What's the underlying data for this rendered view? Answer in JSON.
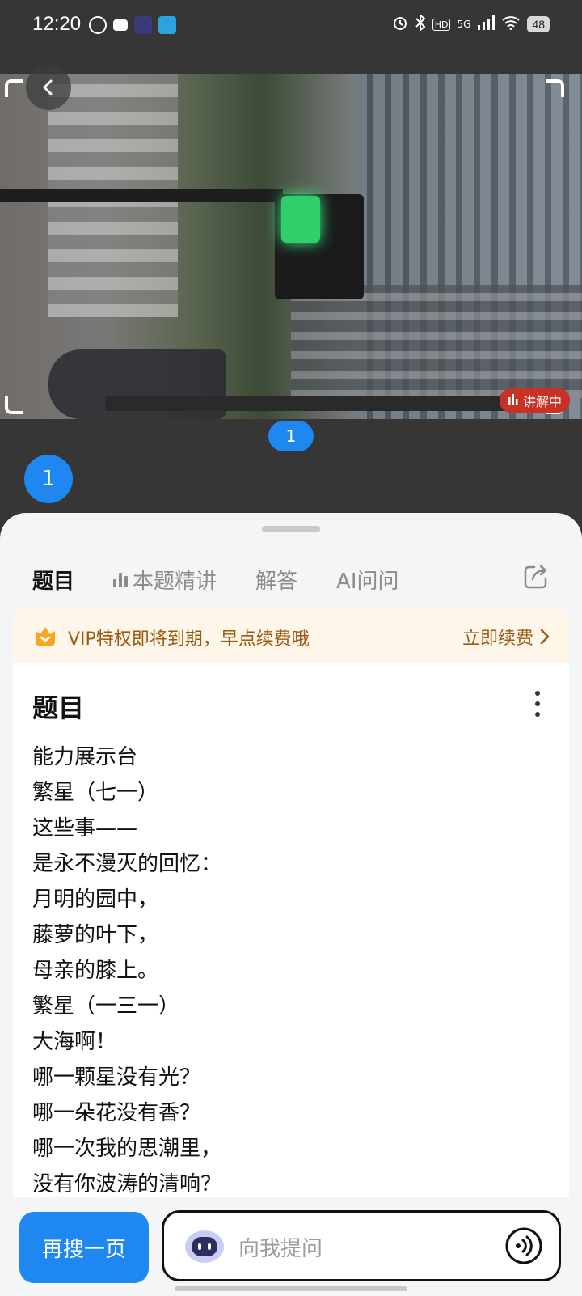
{
  "status_bar": {
    "time": "12:20",
    "signal": "5G",
    "hd": "HD",
    "battery": "48"
  },
  "photo": {
    "live_badge": "讲解中",
    "marker_number": "1"
  },
  "question_number": "1",
  "tabs": [
    {
      "label": "题目",
      "active": true
    },
    {
      "label": "本题精讲",
      "active": false
    },
    {
      "label": "解答",
      "active": false
    },
    {
      "label": "AI问问",
      "active": false
    }
  ],
  "vip": {
    "text": "VIP特权即将到期，早点续费哦",
    "renew": "立即续费"
  },
  "card": {
    "title": "题目",
    "lines": [
      "能力展示台",
      "繁星（七一）",
      "这些事——",
      "是永不漫灭的回忆：",
      "月明的园中，",
      "藤萝的叶下，",
      "母亲的膝上。",
      "繁星（一三一）",
      "大海啊！",
      "哪一颗星没有光？",
      "哪一朵花没有香？",
      "哪一次我的思潮里，",
      "没有你波涛的清响？"
    ]
  },
  "bottom": {
    "search_again": "再搜一页",
    "ask_placeholder": "向我提问"
  },
  "colors": {
    "accent": "#1e88f0",
    "vip_bg": "#fef6e9",
    "vip_text": "#9a5a12",
    "live_badge": "#c83225"
  }
}
